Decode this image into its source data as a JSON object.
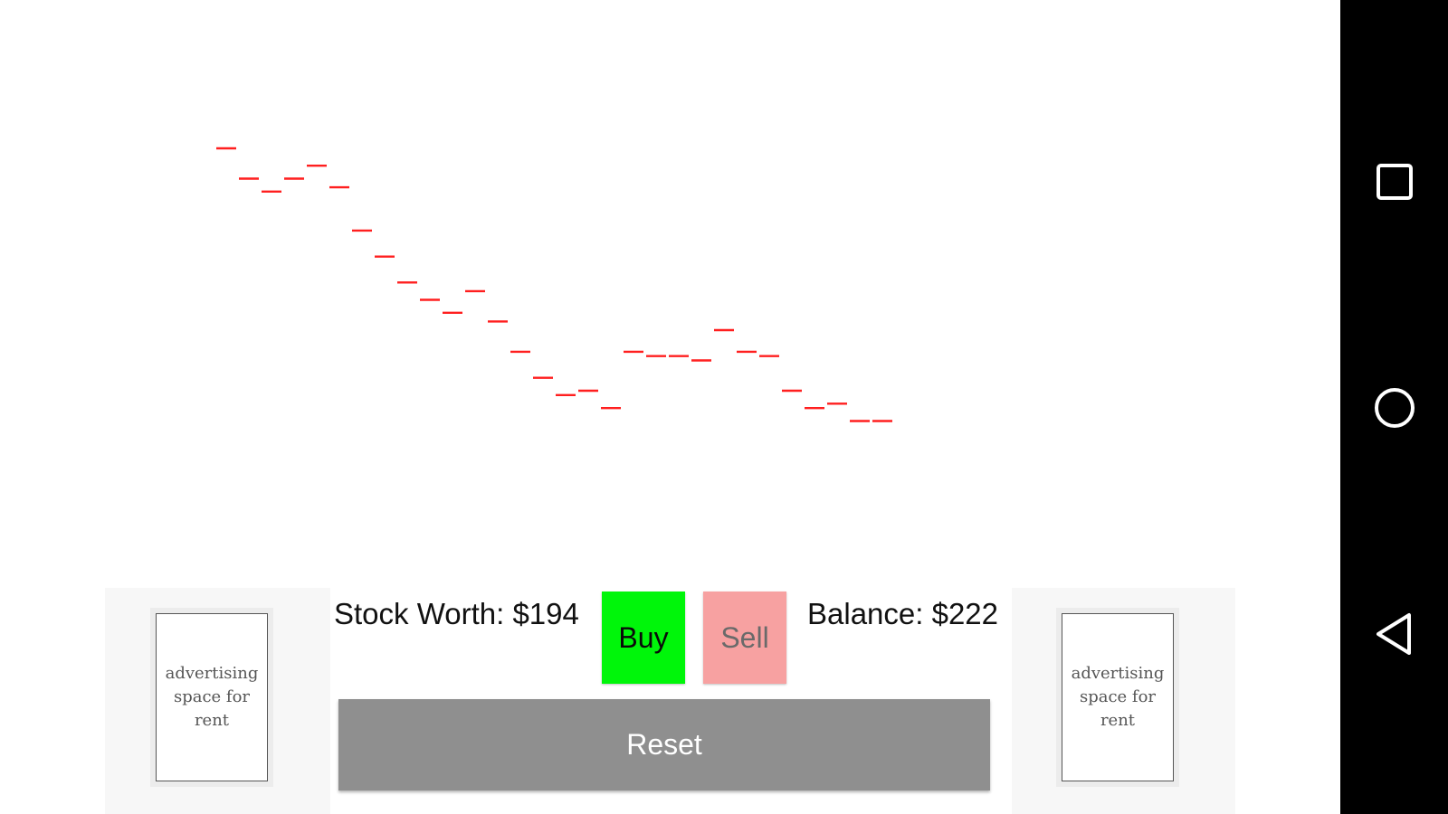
{
  "colors": {
    "chart_mark": "#ff1f1f",
    "buy": "#00f60a",
    "sell": "#f7a1a1",
    "reset": "#8f8f8f",
    "nav_bar": "#000000"
  },
  "chart_data": {
    "type": "scatter",
    "title": "",
    "xlabel": "",
    "ylabel": "",
    "x": [
      1,
      2,
      3,
      4,
      5,
      6,
      7,
      8,
      9,
      10,
      11,
      12,
      13,
      14,
      15,
      16,
      17,
      18,
      19,
      20,
      21,
      22,
      23,
      24,
      25,
      26,
      27,
      28,
      29,
      30,
      31
    ],
    "values": [
      100,
      93,
      90,
      93,
      96,
      91,
      81,
      75,
      69,
      65,
      62,
      67,
      60,
      53,
      47,
      43,
      44,
      40,
      53,
      52,
      52,
      51,
      58,
      53,
      52,
      44,
      40,
      41,
      37,
      37,
      null
    ],
    "y_range": [
      30,
      100
    ],
    "grid": false,
    "legend": false
  },
  "stats": {
    "stock_worth": "Stock Worth: $194",
    "balance": "Balance: $222"
  },
  "buttons": {
    "buy": "Buy",
    "sell": "Sell",
    "reset": "Reset"
  },
  "ads": {
    "left": "advertising space for rent",
    "right": "advertising space for rent"
  },
  "navigation": {
    "recents_icon": "square-icon",
    "home_icon": "circle-icon",
    "back_icon": "triangle-back-icon"
  }
}
